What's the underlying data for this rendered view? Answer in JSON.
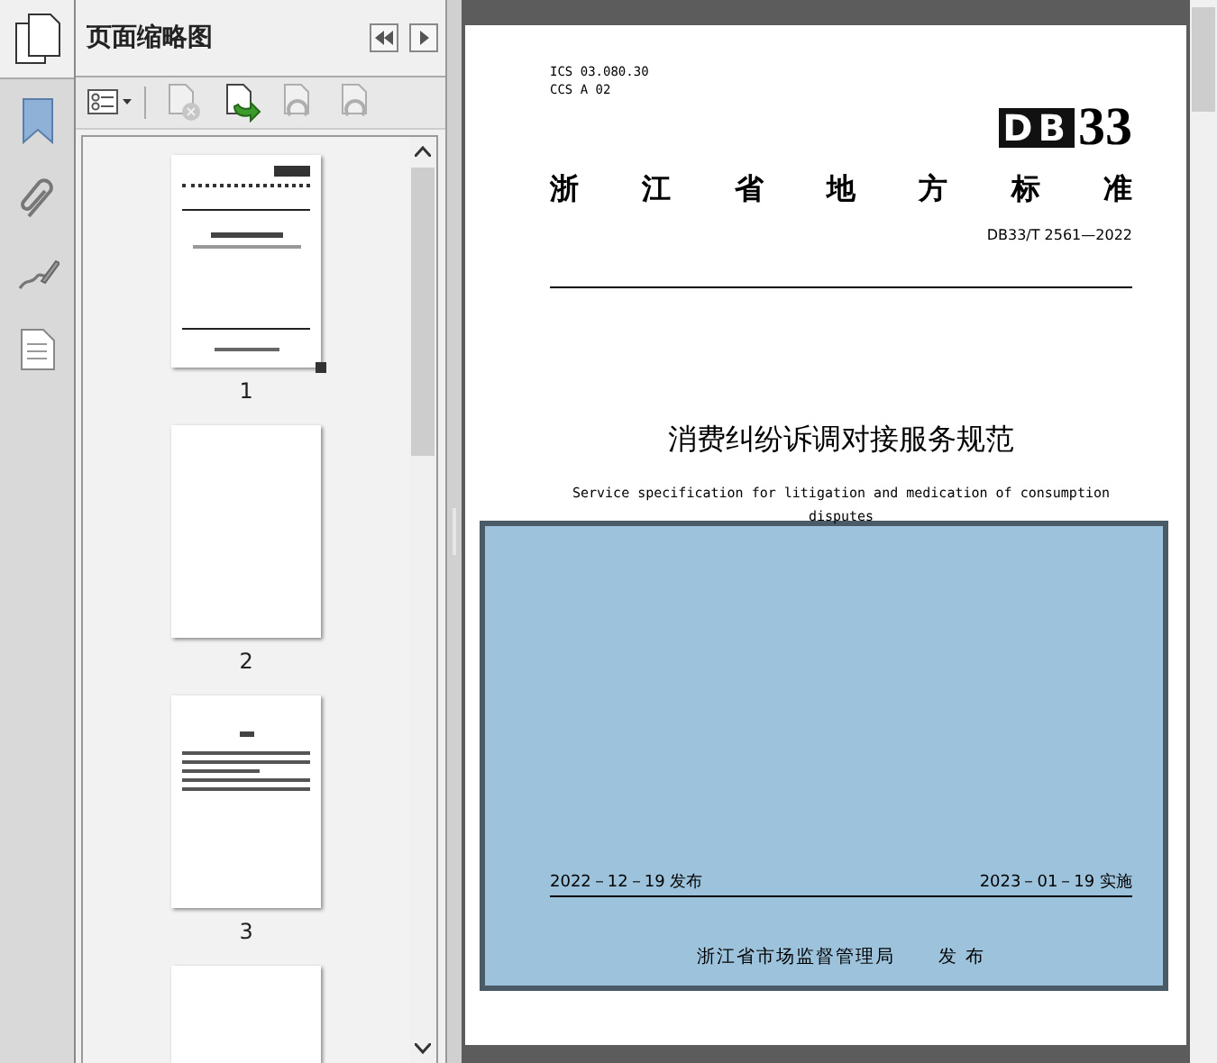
{
  "side_tools": [
    {
      "kind": "bookmark"
    },
    {
      "kind": "paperclip"
    },
    {
      "kind": "signature"
    },
    {
      "kind": "document"
    }
  ],
  "panel": {
    "title": "页面缩略图"
  },
  "panel_toolbar": [
    {
      "kind": "options",
      "disabled": false
    },
    {
      "kind": "delete",
      "disabled": true
    },
    {
      "kind": "insert",
      "disabled": false
    },
    {
      "kind": "undo",
      "disabled": true
    },
    {
      "kind": "redo",
      "disabled": true
    }
  ],
  "thumbnails": [
    {
      "kind": "cover",
      "label": "1",
      "selected": true
    },
    {
      "kind": "blank",
      "label": "2",
      "selected": false
    },
    {
      "kind": "text",
      "label": "3",
      "selected": false
    },
    {
      "kind": "blank"
    }
  ],
  "document": {
    "ics": "ICS 03.080.30",
    "ccs": "CCS A 02",
    "logo_prefix": "DB",
    "logo_suffix": "33",
    "issuer_title": "浙江省地方标准",
    "code": "DB33/T 2561—2022",
    "title": "消费纠纷诉调对接服务规范",
    "english_title": "Service specification for litigation and medication of consumption disputes",
    "publish_date": "2022－12－19 发布",
    "effective_date": "2023－01－19 实施",
    "publisher": "浙江省市场监督管理局",
    "publisher_suffix": "发 布"
  }
}
